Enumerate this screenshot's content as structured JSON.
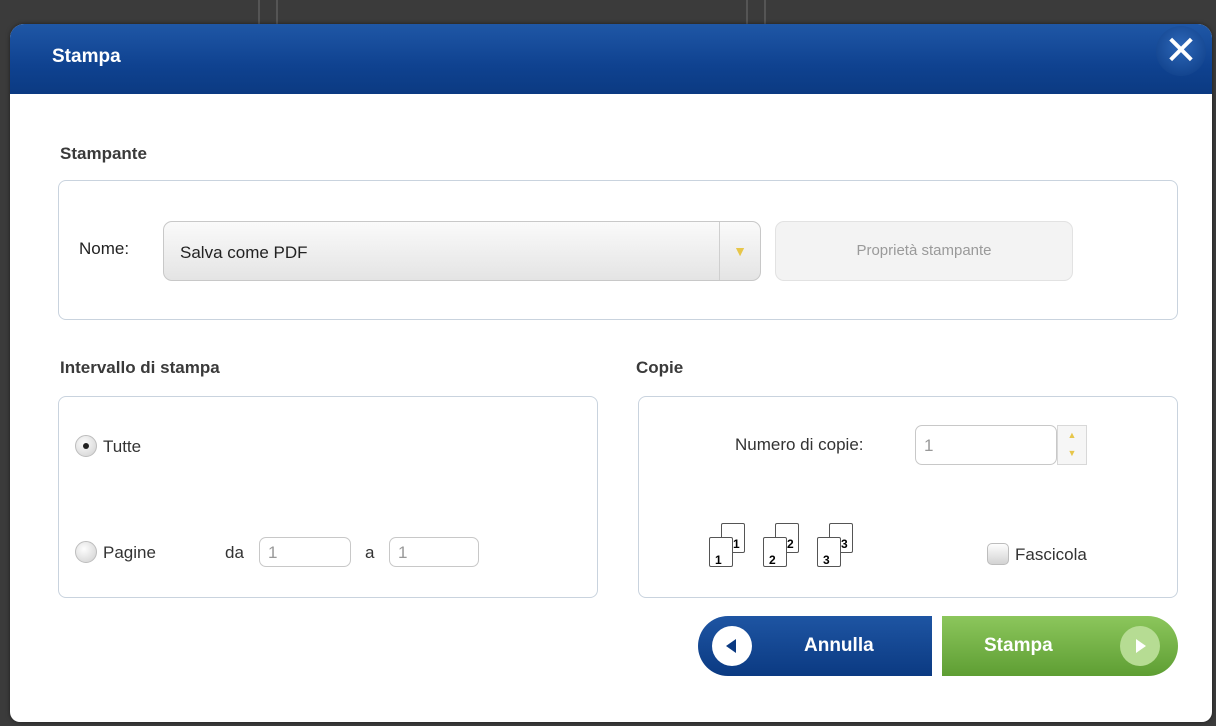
{
  "dialog": {
    "title": "Stampa",
    "close_icon": "close-icon"
  },
  "printer": {
    "section_label": "Stampante",
    "name_label": "Nome:",
    "selected": "Salva come PDF",
    "properties_button": "Proprietà stampante"
  },
  "range": {
    "section_label": "Intervallo di stampa",
    "all_label": "Tutte",
    "pages_label": "Pagine",
    "from_label": "da",
    "from_value": "1",
    "to_label": "a",
    "to_value": "1",
    "selected": "Tutte"
  },
  "copies": {
    "section_label": "Copie",
    "count_label": "Numero di copie:",
    "count_value": "1",
    "collate_label": "Fascicola",
    "collate_checked": false,
    "collate_icon_numbers": [
      "1",
      "1",
      "2",
      "2",
      "3",
      "3"
    ]
  },
  "actions": {
    "cancel_label": "Annulla",
    "print_label": "Stampa"
  },
  "colors": {
    "title_bar": "#0f4290",
    "cancel_button": "#0b3a82",
    "print_button": "#6aab3c"
  }
}
